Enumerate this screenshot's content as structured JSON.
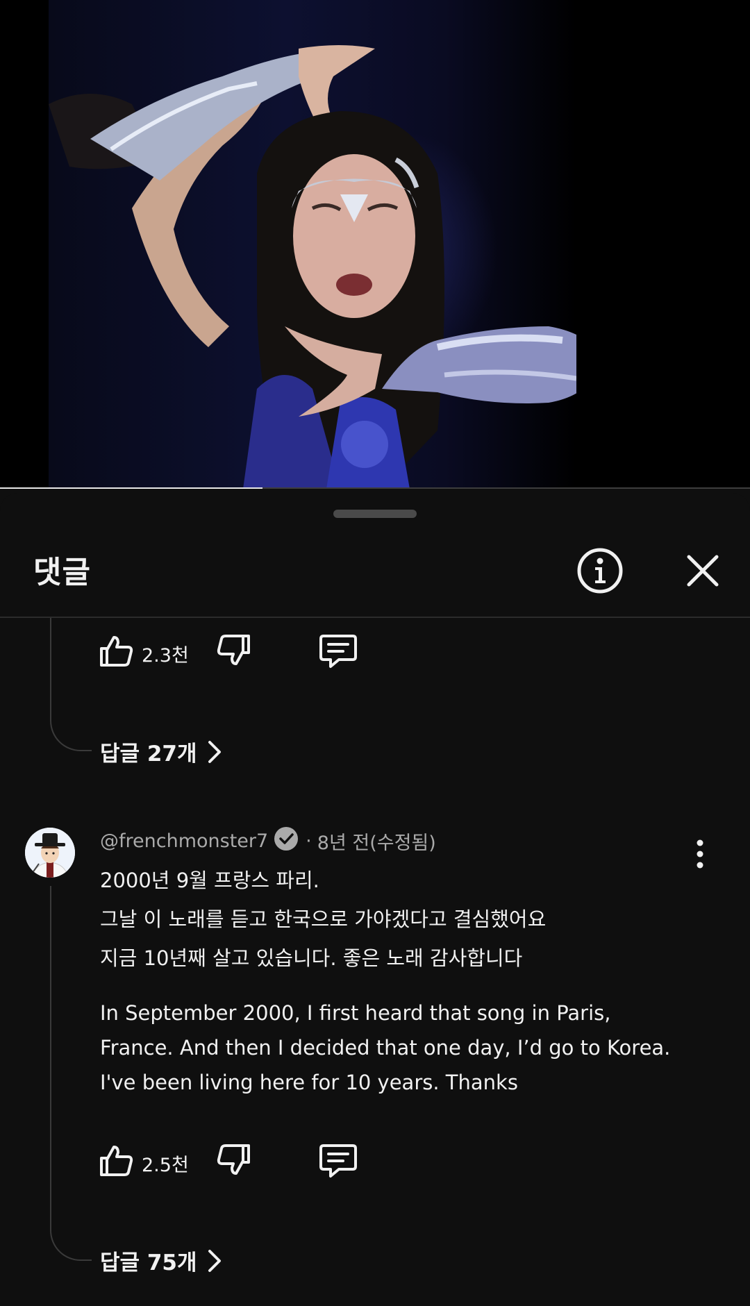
{
  "video": {
    "progress_percent": 35
  },
  "sheet": {
    "title": "댓글",
    "icons": {
      "info": "info-circle-icon",
      "close": "close-x-icon",
      "drag": "drag-handle"
    }
  },
  "top_comment": {
    "likes": "2.3천",
    "replies_label": "답글 27개"
  },
  "comment": {
    "author": "@frenchmonster7",
    "verified": true,
    "time": "8년 전(수정됨)",
    "lines_ko": [
      "2000년 9월 프랑스 파리.",
      "그날 이 노래를 듣고 한국으로 가야겠다고 결심했어요",
      "지금 10년째 살고 있습니다. 좋은 노래 감사합니다"
    ],
    "lines_en": [
      "In September 2000, I first heard that song in Paris,",
      "France. And then I decided that one day, I’d go to Korea.",
      "I've been living here for 10 years. Thanks"
    ],
    "likes": "2.5천",
    "replies_label": "답글 75개"
  },
  "colors": {
    "background": "#0f0f0f",
    "text": "#f1f1f1",
    "muted": "#aaaaaa",
    "divider": "#2c2c2c"
  }
}
